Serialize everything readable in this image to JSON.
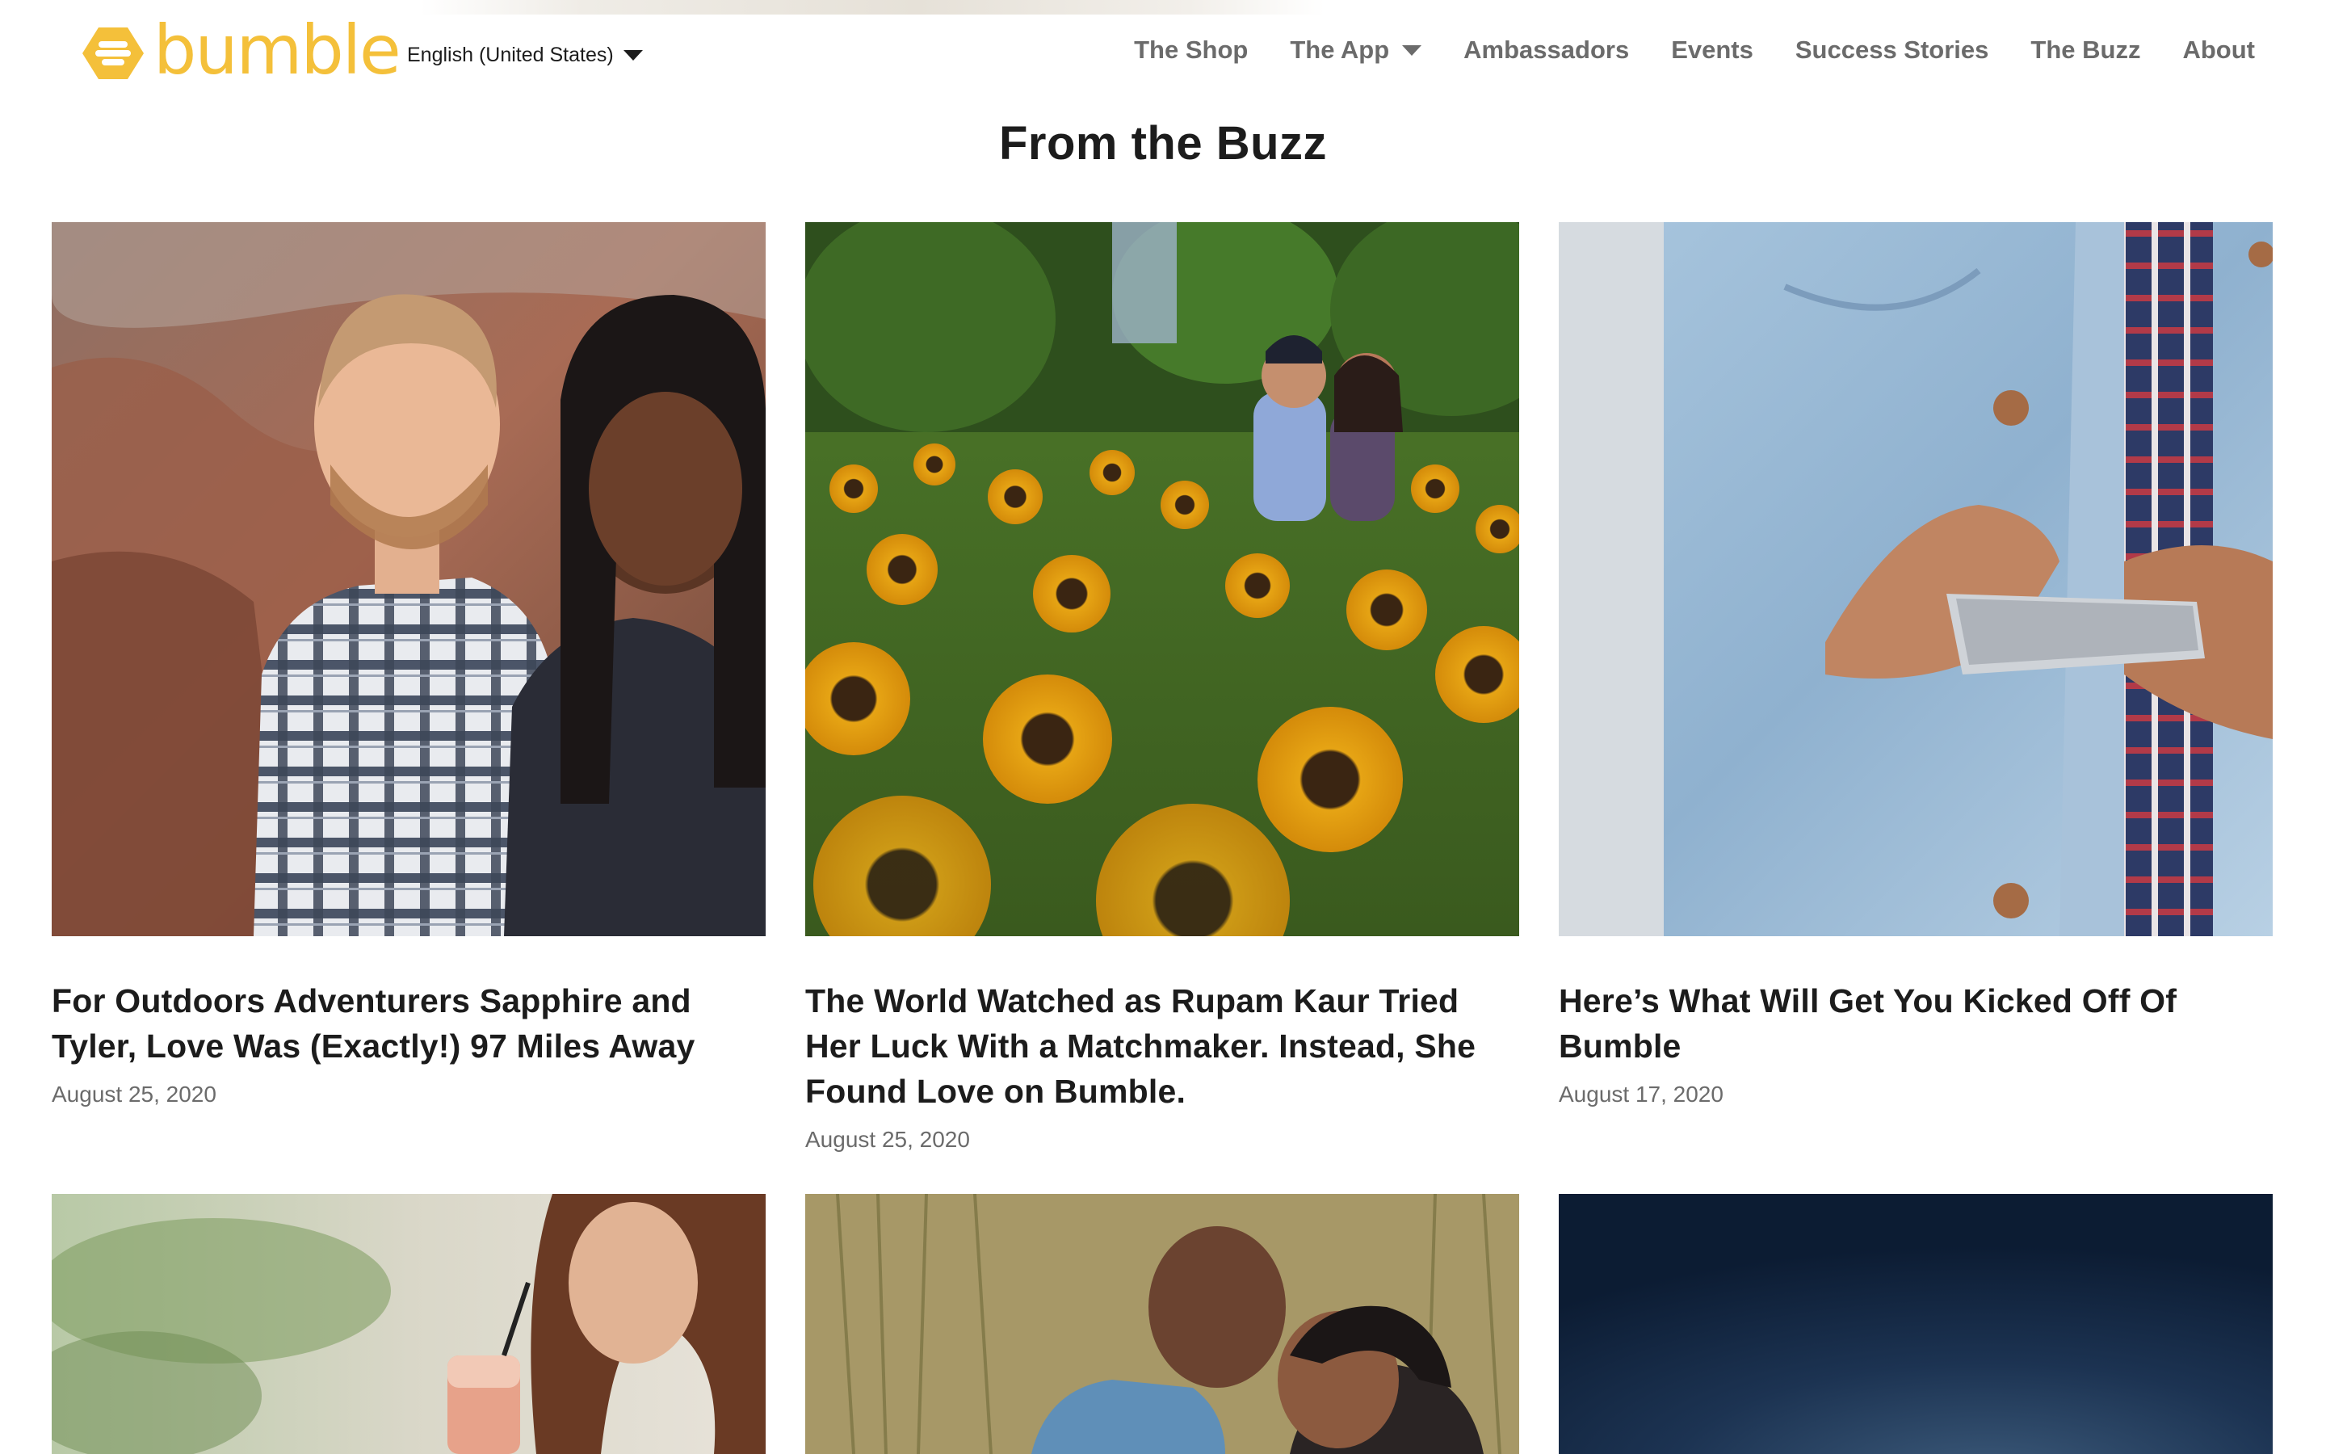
{
  "header": {
    "logo_text": "bumble",
    "language": "English (United States)",
    "nav": [
      {
        "label": "The Shop",
        "has_dropdown": false
      },
      {
        "label": "The App",
        "has_dropdown": true
      },
      {
        "label": "Ambassadors",
        "has_dropdown": false
      },
      {
        "label": "Events",
        "has_dropdown": false
      },
      {
        "label": "Success Stories",
        "has_dropdown": false
      },
      {
        "label": "The Buzz",
        "has_dropdown": false
      },
      {
        "label": "About",
        "has_dropdown": false
      }
    ]
  },
  "main": {
    "section_title": "From the Buzz",
    "articles": [
      {
        "title": "For Outdoors Adventurers Sapphire and Tyler, Love Was (Exactly!) 97 Miles Away",
        "date": "August 25, 2020",
        "image": "couple-canyon-photo"
      },
      {
        "title": "The World Watched as Rupam Kaur Tried Her Luck With a Matchmaker. Instead, She Found Love on Bumble.",
        "date": "August 25, 2020",
        "image": "couple-sunflower-field-photo"
      },
      {
        "title": "Here’s What Will Get You Kicked Off Of Bumble",
        "date": "August 17, 2020",
        "image": "denim-jacket-phone-photo"
      },
      {
        "image": "woman-with-drink-photo"
      },
      {
        "image": "couple-kissing-grass-photo"
      },
      {
        "image": "night-sky-photo"
      }
    ]
  },
  "colors": {
    "brand_yellow": "#f4c03a",
    "nav_text": "#6b6b6b",
    "heading_text": "#1c1c1c",
    "date_text": "#6b6b6b"
  }
}
